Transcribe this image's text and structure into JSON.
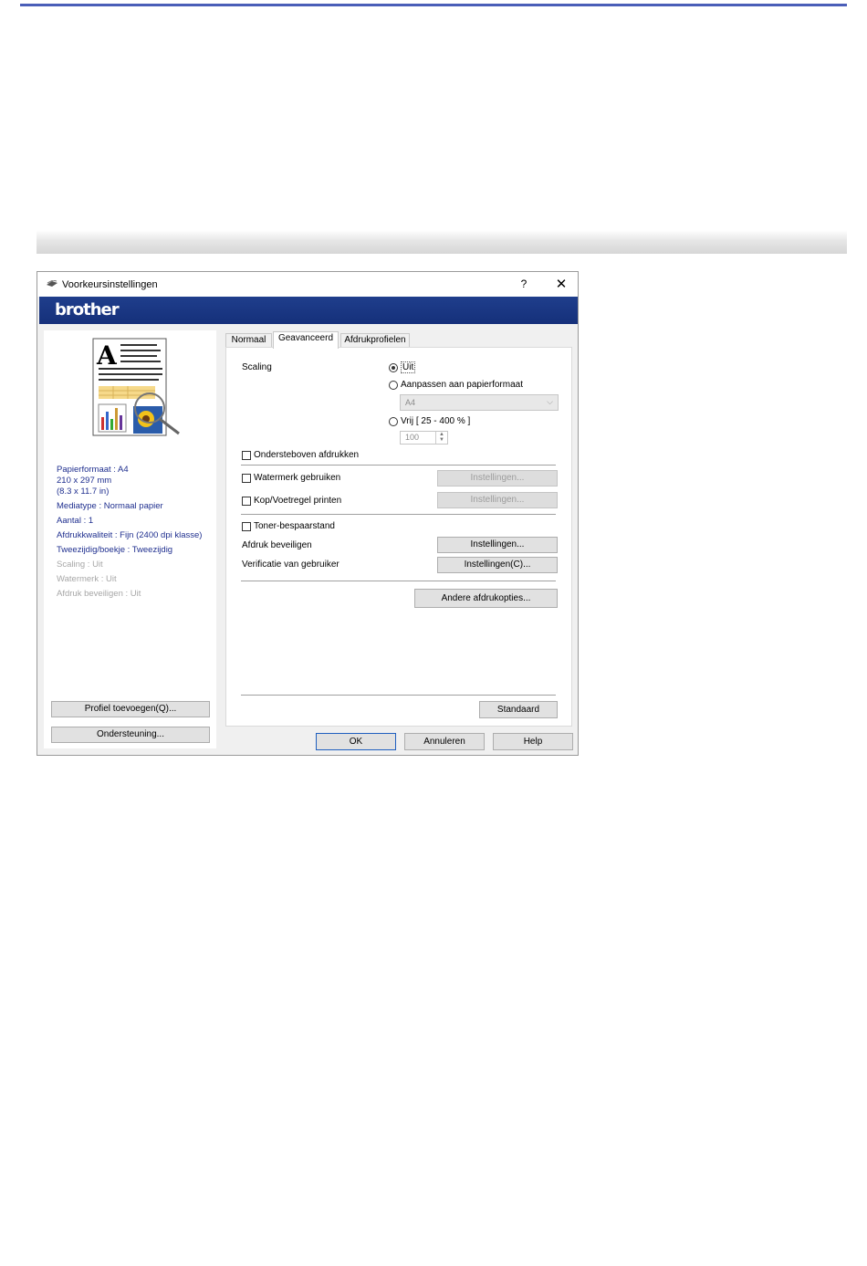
{
  "dialog": {
    "title": "Voorkeursinstellingen",
    "help_symbol": "?",
    "close_symbol": "✕",
    "brand": "brother"
  },
  "summary": {
    "paper_size": "Papierformaat : A4",
    "paper_mm": "210 x 297 mm",
    "paper_in": "(8.3 x 11.7 in)",
    "media_type": "Mediatype : Normaal papier",
    "copies": "Aantal : 1",
    "quality": "Afdrukkwaliteit : Fijn (2400 dpi klasse)",
    "duplex": "Tweezijdig/boekje : Tweezijdig",
    "scaling": "Scaling : Uit",
    "watermark": "Watermerk : Uit",
    "secure_print": "Afdruk beveiligen : Uit"
  },
  "left_buttons": {
    "add_profile": "Profiel toevoegen(Q)...",
    "support": "Ondersteuning..."
  },
  "tabs": [
    "Normaal",
    "Geavanceerd",
    "Afdrukprofielen"
  ],
  "advanced": {
    "scaling_label": "Scaling",
    "scaling_off": "Uit",
    "fit_to_paper": "Aanpassen aan papierformaat",
    "paper_select": "A4",
    "free": "Vrij [ 25 - 400 % ]",
    "free_value": "100",
    "upside_down": "Ondersteboven afdrukken",
    "watermark": "Watermerk gebruiken",
    "header_footer": "Kop/Voetregel printen",
    "settings": "Instellingen...",
    "toner_save": "Toner-bespaarstand",
    "secure_print": "Afdruk beveiligen",
    "user_auth": "Verificatie van gebruiker",
    "settings_c": "Instellingen(C)...",
    "other_options": "Andere afdrukopties...",
    "default": "Standaard"
  },
  "footer": {
    "ok": "OK",
    "cancel": "Annuleren",
    "help": "Help"
  },
  "colors": {
    "banner": "#1f3e8c",
    "summary_text": "#1f2f8f",
    "top_rule": "#4a5eb8"
  }
}
